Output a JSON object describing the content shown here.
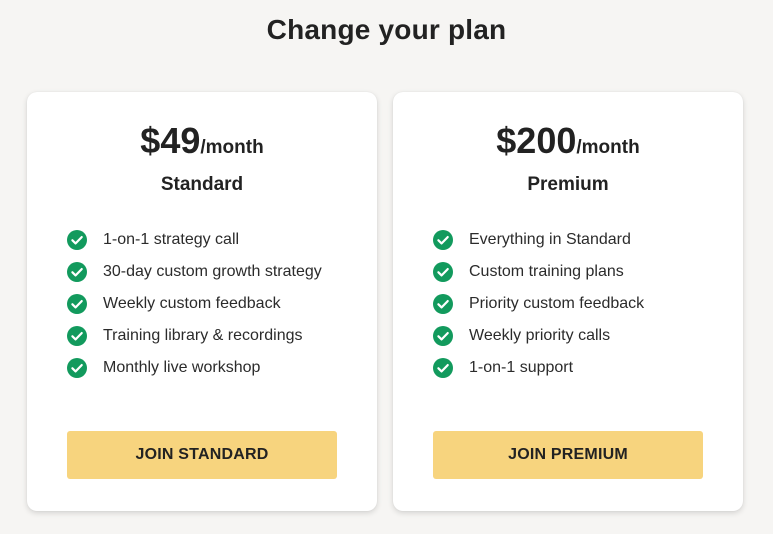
{
  "page": {
    "title": "Change your plan"
  },
  "colors": {
    "background": "#f6f5f3",
    "card": "#ffffff",
    "check": "#129a5d",
    "button": "#f7d47e",
    "text": "#222222"
  },
  "plans": [
    {
      "price": "$49",
      "period": "/month",
      "name": "Standard",
      "features": [
        "1-on-1 strategy call",
        "30-day custom growth strategy",
        "Weekly custom feedback",
        "Training library & recordings",
        "Monthly live workshop"
      ],
      "button_label": "JOIN STANDARD",
      "feature_icon": "check-circle-icon"
    },
    {
      "price": "$200",
      "period": "/month",
      "name": "Premium",
      "features": [
        "Everything in Standard",
        "Custom training plans",
        "Priority custom feedback",
        "Weekly priority calls",
        "1-on-1 support"
      ],
      "button_label": "JOIN PREMIUM",
      "feature_icon": "check-circle-icon"
    }
  ]
}
